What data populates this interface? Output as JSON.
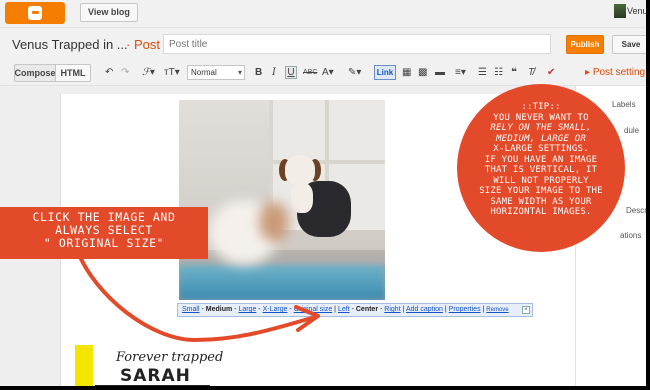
{
  "topbar": {
    "view_blog": "View blog",
    "user_name": "Venus"
  },
  "editor_header": {
    "blog_title": "Venus Trapped in ...",
    "post_label": "· Post",
    "title_placeholder": "Post title",
    "publish": "Publish",
    "save": "Save"
  },
  "toolbar": {
    "compose": "Compose",
    "html": "HTML",
    "font_size": "Normal",
    "link": "Link",
    "icons": [
      "undo-icon",
      "redo-icon",
      "font-family-icon",
      "font-size-icon",
      "bold-icon",
      "italic-icon",
      "underline-icon",
      "strikethrough-icon",
      "text-color-icon",
      "highlight-icon",
      "link-button",
      "image-icon",
      "video-icon",
      "jump-break-icon",
      "align-icon",
      "numbered-list-icon",
      "bulleted-list-icon",
      "quote-icon",
      "clear-formatting-icon",
      "spellcheck-icon"
    ]
  },
  "sidebar": {
    "post_settings": "Post setting",
    "items": [
      "Labels",
      "dule",
      "Descr",
      "ations"
    ]
  },
  "image_toolbar": {
    "small": "Small",
    "medium": "Medium",
    "large": "Large",
    "xlarge": "X-Large",
    "original": "Original size",
    "left": "Left",
    "center": "Center",
    "right": "Right",
    "add_caption": "Add caption",
    "properties": "Properties",
    "remove": "Remove"
  },
  "callout": {
    "lines": [
      "CLICK THE IMAGE AND",
      "ALWAYS SELECT",
      "\" ORIGINAL SIZE\""
    ]
  },
  "tip": {
    "heading": "::TIP::",
    "lines": [
      "YOU NEVER WANT TO",
      "RELY ON THE SMALL,",
      "MEDIUM, LARGE OR",
      "X-LARGE SETTINGS.",
      "IF YOU HAVE AN IMAGE",
      "THAT IS VERTICAL, IT",
      "WILL NOT PROPERLY",
      "SIZE YOUR IMAGE TO THE",
      "SAME WIDTH AS YOUR",
      "HORIZONTAL IMAGES."
    ]
  },
  "post_content": {
    "script_title": "Forever trapped",
    "name": "SARAH"
  },
  "colors": {
    "accent": "#e24a2a",
    "blogger_orange": "#f57d00",
    "link": "#1155cc"
  }
}
